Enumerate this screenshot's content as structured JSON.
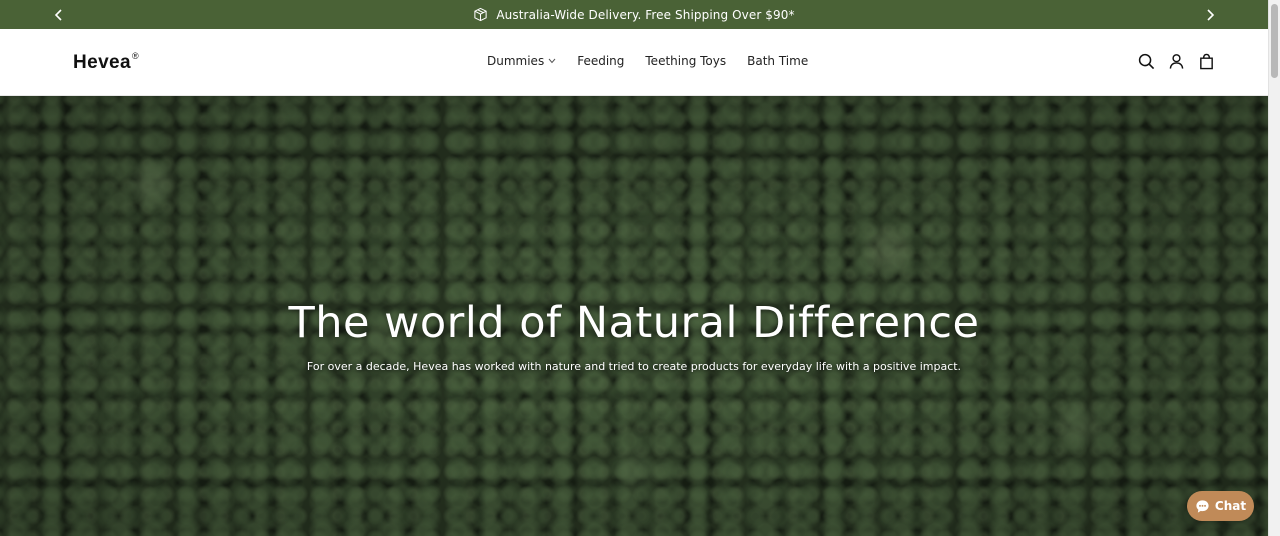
{
  "announcement": {
    "message": "Australia-Wide Delivery. Free Shipping Over $90*",
    "background_color": "#4a6236",
    "icons": {
      "prev": "chevron-left-icon",
      "next": "chevron-right-icon",
      "message": "box-icon"
    }
  },
  "header": {
    "logo": {
      "text": "Hevea",
      "mark": "®"
    },
    "nav": [
      {
        "label": "Dummies",
        "has_dropdown": true
      },
      {
        "label": "Feeding"
      },
      {
        "label": "Teething Toys"
      },
      {
        "label": "Bath Time"
      }
    ],
    "icons": [
      "search-icon",
      "account-icon",
      "cart-icon"
    ]
  },
  "hero": {
    "title": "The world of Natural Difference",
    "subtitle": "For over a decade, Hevea has worked with nature and tried to create products for everyday life with a positive impact."
  },
  "chat": {
    "label": "Chat",
    "color": "#c08a58",
    "icon": "chat-bubble-icon"
  }
}
